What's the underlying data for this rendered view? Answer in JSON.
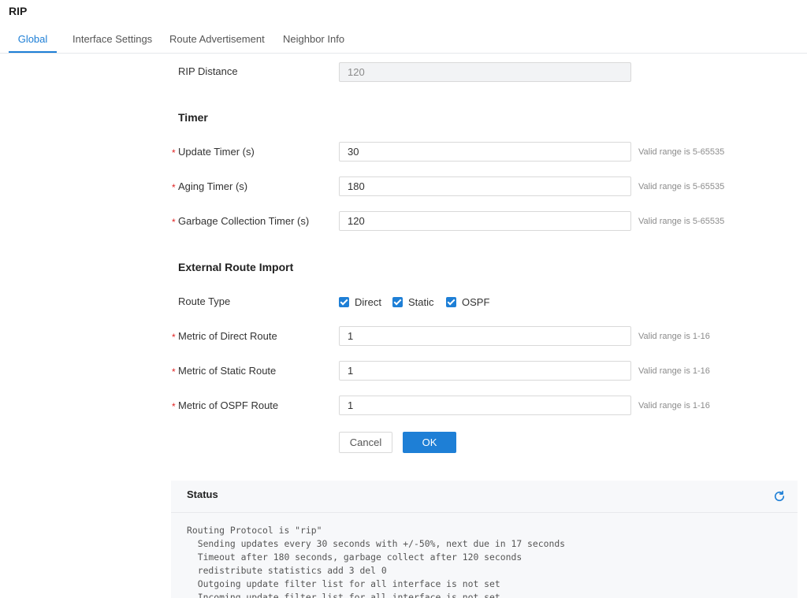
{
  "page": {
    "title": "RIP"
  },
  "tabs": [
    {
      "label": "Global",
      "active": true
    },
    {
      "label": "Interface Settings",
      "active": false
    },
    {
      "label": "Route Advertisement",
      "active": false
    },
    {
      "label": "Neighbor Info",
      "active": false
    }
  ],
  "form": {
    "rip_distance": {
      "label": "RIP Distance",
      "value": "120"
    },
    "timer_section": "Timer",
    "update_timer": {
      "label": "Update Timer (s)",
      "value": "30",
      "hint": "Valid range is 5-65535"
    },
    "aging_timer": {
      "label": "Aging Timer (s)",
      "value": "180",
      "hint": "Valid range is 5-65535"
    },
    "garbage_timer": {
      "label": "Garbage Collection Timer (s)",
      "value": "120",
      "hint": "Valid range is 5-65535"
    },
    "external_section": "External Route Import",
    "route_type": {
      "label": "Route Type",
      "options": [
        {
          "label": "Direct",
          "checked": true
        },
        {
          "label": "Static",
          "checked": true
        },
        {
          "label": "OSPF",
          "checked": true
        }
      ]
    },
    "metric_direct": {
      "label": "Metric of Direct Route",
      "value": "1",
      "hint": "Valid range is 1-16"
    },
    "metric_static": {
      "label": "Metric of Static Route",
      "value": "1",
      "hint": "Valid range is 1-16"
    },
    "metric_ospf": {
      "label": "Metric of OSPF Route",
      "value": "1",
      "hint": "Valid range is 1-16"
    },
    "required_mark": "*"
  },
  "buttons": {
    "cancel": "Cancel",
    "ok": "OK"
  },
  "status": {
    "title": "Status",
    "lines": [
      "Routing Protocol is \"rip\"",
      "  Sending updates every 30 seconds with +/-50%, next due in 17 seconds",
      "  Timeout after 180 seconds, garbage collect after 120 seconds",
      "  redistribute statistics add 3 del 0",
      "  Outgoing update filter list for all interface is not set",
      "  Incoming update filter list for all interface is not set"
    ]
  },
  "icons": {
    "refresh": "refresh-icon",
    "checkbox": "checkmark-icon"
  },
  "colors": {
    "accent": "#1e7fd6",
    "required": "#e02424",
    "hint": "#8c8c8c",
    "panel": "#f7f8fa"
  }
}
